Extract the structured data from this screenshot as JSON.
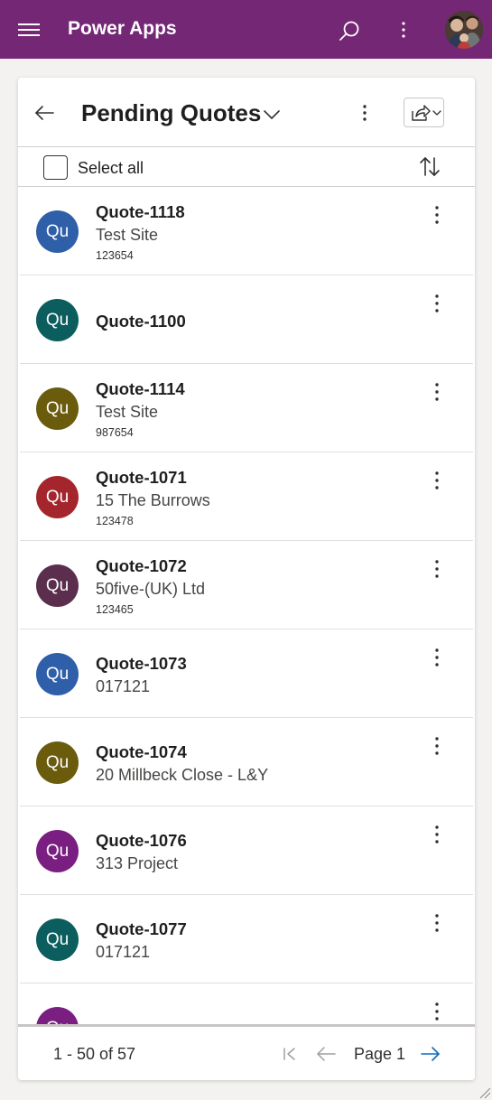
{
  "app": {
    "title": "Power Apps"
  },
  "view": {
    "title": "Pending Quotes",
    "select_all_label": "Select all"
  },
  "records": [
    {
      "initials": "Qu",
      "name": "Quote-1118",
      "subtitle": "Test Site",
      "detail": "123654",
      "color": "#2f5fa8"
    },
    {
      "initials": "Qu",
      "name": "Quote-1100",
      "subtitle": "",
      "detail": "",
      "color": "#0b5d5e"
    },
    {
      "initials": "Qu",
      "name": "Quote-1114",
      "subtitle": "Test Site",
      "detail": "987654",
      "color": "#6b5b0d"
    },
    {
      "initials": "Qu",
      "name": "Quote-1071",
      "subtitle": "15 The Burrows",
      "detail": "123478",
      "color": "#a4262c"
    },
    {
      "initials": "Qu",
      "name": "Quote-1072",
      "subtitle": "50five-(UK) Ltd",
      "detail": "123465",
      "color": "#5c2e4d"
    },
    {
      "initials": "Qu",
      "name": "Quote-1073",
      "subtitle": "017121",
      "detail": "",
      "color": "#2f5fa8"
    },
    {
      "initials": "Qu",
      "name": "Quote-1074",
      "subtitle": "20 Millbeck Close - L&Y",
      "detail": "",
      "color": "#6b5b0d"
    },
    {
      "initials": "Qu",
      "name": "Quote-1076",
      "subtitle": "313 Project",
      "detail": "",
      "color": "#7a1e82"
    },
    {
      "initials": "Qu",
      "name": "Quote-1077",
      "subtitle": "017121",
      "detail": "",
      "color": "#0b5d5e"
    },
    {
      "initials": "Qu",
      "name": "",
      "subtitle": "",
      "detail": "",
      "color": "#7a1e82"
    }
  ],
  "pagination": {
    "range": "1 - 50 of 57",
    "page_label": "Page 1"
  },
  "icons": {
    "menu": "hamburger-icon",
    "search": "search-icon",
    "more": "more-vertical-icon",
    "back": "back-arrow-icon",
    "chevron": "chevron-down-icon",
    "share": "share-icon",
    "sort": "sort-icon",
    "first": "first-page-icon",
    "prev": "previous-page-icon",
    "next": "next-page-icon"
  },
  "colors": {
    "header": "#742774",
    "accent": "#0f6cbd"
  }
}
